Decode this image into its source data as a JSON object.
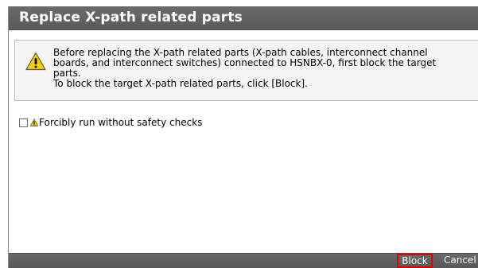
{
  "dialog": {
    "title": "Replace X-path related parts"
  },
  "warning": {
    "icon": "warning-triangle-icon",
    "lines": [
      "Before replacing the X-path related parts (X-path cables, interconnect channel",
      "boards, and interconnect switches) connected to HSNBX-0, first block the target",
      "parts.",
      "To block the target X-path related parts, click [Block]."
    ]
  },
  "options": {
    "force_checkbox_checked": false,
    "force_label": "Forcibly run without safety checks"
  },
  "footer": {
    "block_label": "Block",
    "cancel_label": "Cancel"
  },
  "colors": {
    "titlebar": "#606060",
    "highlight_border": "#e00000",
    "warning_fill": "#f5d000"
  }
}
